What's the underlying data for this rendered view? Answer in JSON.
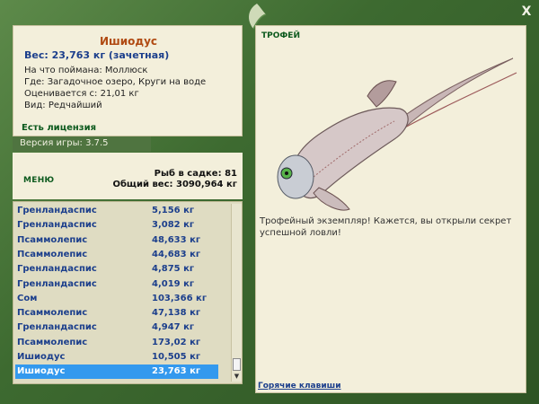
{
  "window": {
    "close_label": "X"
  },
  "fish": {
    "name": "Ишиодус",
    "weight_line": "Вес: 23,763 кг (зачетная)",
    "bait": "На что поймана: Моллюск",
    "location": "Где: Загадочное озеро, Круги на воде",
    "value": "Оценивается с: 21,01 кг",
    "rarity": "Вид: Редчайший"
  },
  "license": "Есть лицензия",
  "version": "Версия игры: 3.7.5",
  "menu_label": "МЕНЮ",
  "stats": {
    "fish_count": "Рыб в садке: 81",
    "total_weight": "Общий вес: 3090,964 кг"
  },
  "catch_list": [
    {
      "name": "Гренландаспис",
      "weight": "5,156 кг"
    },
    {
      "name": "Гренландаспис",
      "weight": "3,082 кг"
    },
    {
      "name": "Псаммолепис",
      "weight": "48,633 кг"
    },
    {
      "name": "Псаммолепис",
      "weight": "44,683 кг"
    },
    {
      "name": "Гренландаспис",
      "weight": "4,875 кг"
    },
    {
      "name": "Гренландаспис",
      "weight": "4,019 кг"
    },
    {
      "name": "Сом",
      "weight": "103,366 кг"
    },
    {
      "name": "Псаммолепис",
      "weight": "47,138 кг"
    },
    {
      "name": "Гренландаспис",
      "weight": "4,947 кг"
    },
    {
      "name": "Псаммолепис",
      "weight": "173,02 кг"
    },
    {
      "name": "Ишиодус",
      "weight": "10,505 кг"
    },
    {
      "name": "Ишиодус",
      "weight": "23,763 кг"
    }
  ],
  "selected_index": 11,
  "trophy": {
    "title": "ТРОФЕЙ",
    "text": "Трофейный экземпляр! Кажется, вы открыли секрет успешной ловли!",
    "hotkeys": "Горячие клавиши"
  },
  "colors": {
    "background": "#3f6b33",
    "panel": "#f3efdb",
    "name_orange": "#b04a12",
    "text_blue": "#1c3f8c",
    "selection": "#3399ee"
  },
  "icons": {
    "logo": "leaf-logo-icon",
    "close": "close-icon",
    "scroll_down": "scroll-down-arrow-icon"
  }
}
